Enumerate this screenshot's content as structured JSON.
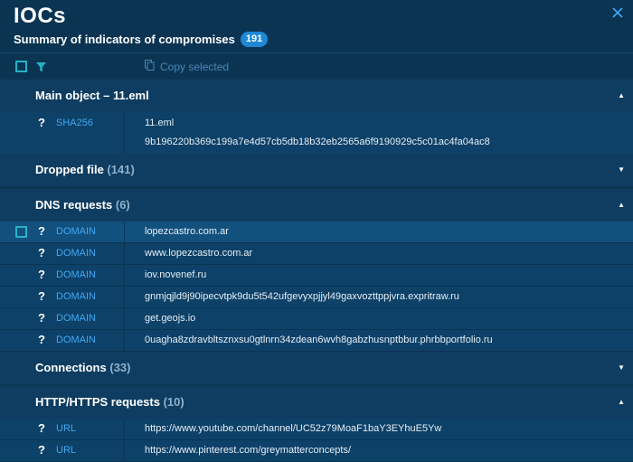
{
  "header": {
    "title": "IOCs",
    "subtitle": "Summary of indicators of compromises",
    "count": "191"
  },
  "toolbar": {
    "copy_label": "Copy selected"
  },
  "sections": {
    "main": {
      "title": "Main object – 11.eml"
    },
    "dropped": {
      "title": "Dropped file",
      "count": "(141)"
    },
    "dns": {
      "title": "DNS requests",
      "count": "(6)"
    },
    "connections": {
      "title": "Connections",
      "count": "(33)"
    },
    "http": {
      "title": "HTTP/HTTPS requests",
      "count": "(10)"
    }
  },
  "main_object": {
    "q": "?",
    "type": "SHA256",
    "name": "11.eml",
    "hash": "9b196220b369c199a7e4d57cb5db18b32eb2565a6f9190929c5c01ac4fa04ac8"
  },
  "dns_rows": [
    {
      "q": "?",
      "type": "DOMAIN",
      "value": "lopezcastro.com.ar"
    },
    {
      "q": "?",
      "type": "DOMAIN",
      "value": "www.lopezcastro.com.ar"
    },
    {
      "q": "?",
      "type": "DOMAIN",
      "value": "iov.novenef.ru"
    },
    {
      "q": "?",
      "type": "DOMAIN",
      "value": "gnmjqjld9j90ipecvtpk9du5t542ufgevyxpjjyl49gaxvozttppjvra.expritraw.ru"
    },
    {
      "q": "?",
      "type": "DOMAIN",
      "value": "get.geojs.io"
    },
    {
      "q": "?",
      "type": "DOMAIN",
      "value": "0uagha8zdravbltsznxsu0gtlnrn34zdean6wvh8gabzhusnptbbur.phrbbportfolio.ru"
    }
  ],
  "http_rows": [
    {
      "q": "?",
      "type": "URL",
      "value": "https://www.youtube.com/channel/UC52z79MoaF1baY3EYhuE5Yw"
    },
    {
      "q": "?",
      "type": "URL",
      "value": "https://www.pinterest.com/greymatterconcepts/"
    }
  ],
  "icons": {
    "close": "close-icon",
    "filter": "filter-icon",
    "copy": "copy-icon",
    "caret_up": "caret-up-icon",
    "caret_down": "caret-down-icon"
  },
  "colors": {
    "background": "#0b3453",
    "section": "#0f3d61",
    "row": "#0d4168",
    "accent": "#3fa9f5",
    "badge": "#1e88d6",
    "checkbox": "#27b3c9"
  }
}
